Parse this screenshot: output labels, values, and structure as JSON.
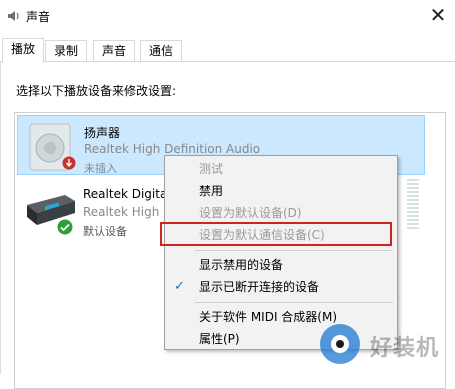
{
  "window": {
    "title": "声音",
    "close_glyph": "✕"
  },
  "tabs": [
    {
      "label": "播放",
      "active": true
    },
    {
      "label": "录制",
      "active": false
    },
    {
      "label": "声音",
      "active": false
    },
    {
      "label": "通信",
      "active": false
    }
  ],
  "instruction": "选择以下播放设备来修改设置:",
  "devices": [
    {
      "name": "扬声器",
      "driver": "Realtek High Definition Audio",
      "status": "未插入",
      "icon": "speaker-icon",
      "status_icon": "unplugged-badge-icon"
    },
    {
      "name": "Realtek Digital",
      "driver": "Realtek High D",
      "status": "默认设备",
      "icon": "digital-output-icon",
      "status_icon": "default-check-icon"
    }
  ],
  "context_menu": {
    "items": [
      {
        "label": "测试",
        "disabled": true,
        "checked": false
      },
      {
        "label": "禁用",
        "disabled": false,
        "checked": false
      },
      {
        "label": "设置为默认设备(D)",
        "disabled": true,
        "checked": false
      },
      {
        "label": "设置为默认通信设备(C)",
        "disabled": true,
        "checked": false
      },
      {
        "label": "显示禁用的设备",
        "disabled": false,
        "checked": false
      },
      {
        "label": "显示已断开连接的设备",
        "disabled": false,
        "checked": true
      },
      {
        "label": "关于软件 MIDI 合成器(M)",
        "disabled": false,
        "checked": false
      },
      {
        "label": "属性(P)",
        "disabled": false,
        "checked": false
      }
    ],
    "check_glyph": "✓",
    "highlight_color": "#d22323"
  },
  "colors": {
    "selection_bg": "#cce8ff",
    "selection_border": "#99d1ff",
    "check": "#1a74c4"
  },
  "watermark": {
    "text": "好装机"
  }
}
